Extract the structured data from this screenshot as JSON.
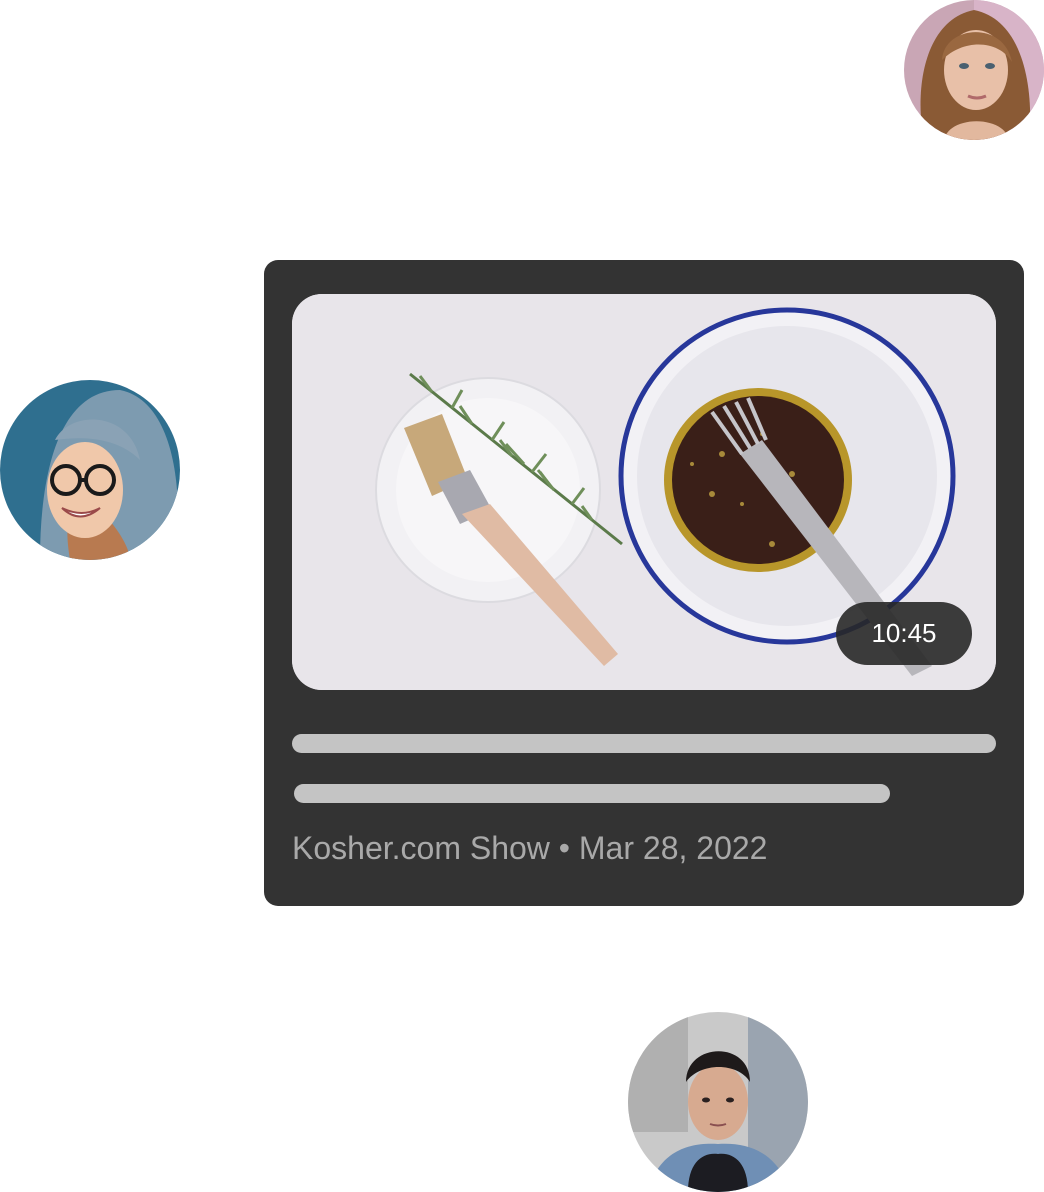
{
  "video_card": {
    "duration": "10:45",
    "channel": "Kosher.com Show",
    "separator": " • ",
    "date": "Mar 28, 2022"
  },
  "avatars": [
    {
      "name": "avatar-top-right",
      "icon": "woman-portrait"
    },
    {
      "name": "avatar-left",
      "icon": "woman-glasses-portrait"
    },
    {
      "name": "avatar-bottom",
      "icon": "man-portrait"
    }
  ],
  "colors": {
    "card_background": "#333333",
    "skeleton": "#c4c4c4",
    "meta_text": "#a9a9a9",
    "duration_badge": "#282828"
  }
}
